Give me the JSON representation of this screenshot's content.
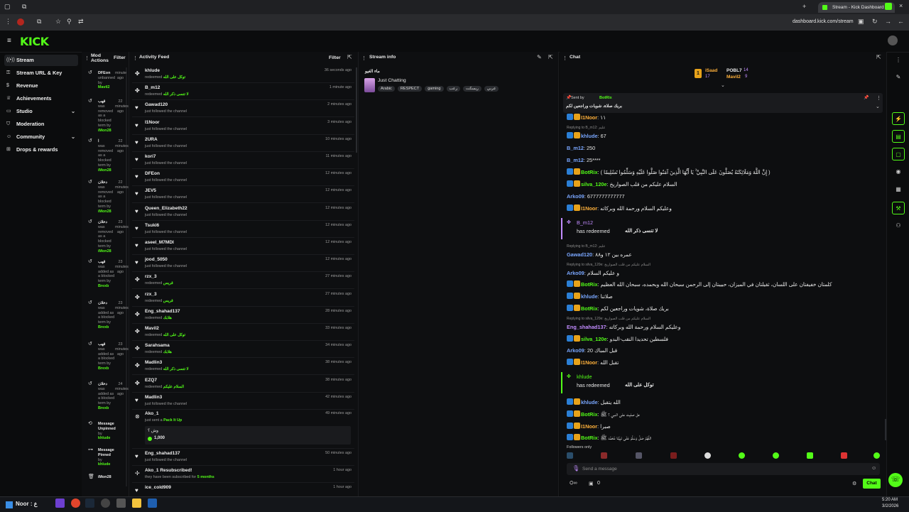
{
  "browser": {
    "tab_title": "Stream - Kick Dashboard",
    "url": "dashboard.kick.com/stream"
  },
  "app": {
    "logo": "KICK"
  },
  "sidebar": {
    "items": [
      {
        "label": "Stream",
        "icon": "broadcast-icon"
      },
      {
        "label": "Stream URL & Key",
        "icon": "key-icon"
      },
      {
        "label": "Revenue",
        "icon": "dollar-icon"
      },
      {
        "label": "Achievements",
        "icon": "trophy-icon"
      },
      {
        "label": "Studio",
        "icon": "studio-icon"
      },
      {
        "label": "Moderation",
        "icon": "shield-icon"
      },
      {
        "label": "Community",
        "icon": "people-icon"
      },
      {
        "label": "Drops & rewards",
        "icon": "gift-icon"
      }
    ]
  },
  "mod_actions": {
    "title": "Mod Actions",
    "filter": "Filter",
    "items": [
      {
        "name": "DFEon",
        "text": "unbanned by",
        "by": "Mavil2",
        "time": "minute ago"
      },
      {
        "name": "قهب",
        "text": "was removed as a blocked term by",
        "by": "iMon28",
        "time": "22 minutes ago"
      },
      {
        "name": "ا",
        "text": "was removed as a blocked term by",
        "by": "iMon28",
        "time": "22 minutes ago"
      },
      {
        "name": "دخلان",
        "text": "was removed as a blocked term by",
        "by": "iMon28",
        "time": "22 minutes ago"
      },
      {
        "name": "دخلان",
        "text": "was removed as a blocked term by",
        "by": "iMon28",
        "time": "23 minutes ago"
      },
      {
        "name": "قهب",
        "text": "was added as a blocked term by",
        "by": "Brexb",
        "time": "23 minutes ago"
      },
      {
        "name": "دخلان",
        "text": "was added as a blocked term by",
        "by": "Brexb",
        "time": "23 minutes ago"
      },
      {
        "name": "قهب",
        "text": "was added as a blocked term by",
        "by": "Brexb",
        "time": "23 minutes ago"
      },
      {
        "name": "دخلان",
        "text": "was added as a blocked term by",
        "by": "Brexb",
        "time": "24 minutes ago"
      },
      {
        "name": "Message Unpinned",
        "text": "by",
        "by": "khlude",
        "time": ""
      },
      {
        "name": "Message Pinned",
        "text": "by",
        "by": "khlude",
        "time": ""
      },
      {
        "name": "iMon28",
        "text": "",
        "by": "",
        "time": ""
      }
    ]
  },
  "activity_feed": {
    "title": "Activity Feed",
    "filter": "Filter",
    "items": [
      {
        "user": "khlude",
        "sub": "redeemed",
        "reward": "توكل على الله",
        "time": "36 seconds ago"
      },
      {
        "user": "B_m12",
        "sub": "redeemed",
        "reward": "لا تنسى ذكر الله",
        "time": "1 minute ago"
      },
      {
        "user": "Gawad120",
        "sub": "just followed the channel",
        "reward": "",
        "time": "2 minutes ago"
      },
      {
        "user": "I1Noor",
        "sub": "just followed the channel",
        "reward": "",
        "time": "3 minutes ago"
      },
      {
        "user": "2URA",
        "sub": "just followed the channel",
        "reward": "",
        "time": "10 minutes ago"
      },
      {
        "user": "kori7",
        "sub": "just followed the channel",
        "reward": "",
        "time": "11 minutes ago"
      },
      {
        "user": "DFEon",
        "sub": "just followed the channel",
        "reward": "",
        "time": "12 minutes ago"
      },
      {
        "user": "JEV5",
        "sub": "just followed the channel",
        "reward": "",
        "time": "12 minutes ago"
      },
      {
        "user": "Queen_Elizabeth22",
        "sub": "just followed the channel",
        "reward": "",
        "time": "12 minutes ago"
      },
      {
        "user": "Tsuki6",
        "sub": "just followed the channel",
        "reward": "",
        "time": "12 minutes ago"
      },
      {
        "user": "aseel_M7MDI",
        "sub": "just followed the channel",
        "reward": "",
        "time": "12 minutes ago"
      },
      {
        "user": "jood_5050",
        "sub": "just followed the channel",
        "reward": "",
        "time": "12 minutes ago"
      },
      {
        "user": "rzx_3",
        "sub": "redeemed",
        "reward": "قريس",
        "time": "27 minutes ago"
      },
      {
        "user": "rzx_3",
        "sub": "redeemed",
        "reward": "قريس",
        "time": "27 minutes ago"
      },
      {
        "user": "Eng_shahad137",
        "sub": "redeemed",
        "reward": "هلابك",
        "time": "28 minutes ago"
      },
      {
        "user": "Mavil2",
        "sub": "redeemed",
        "reward": "توكل على الله",
        "time": "33 minutes ago"
      },
      {
        "user": "Sarahsama",
        "sub": "redeemed",
        "reward": "هلابك",
        "time": "34 minutes ago"
      },
      {
        "user": "Madlin3",
        "sub": "redeemed",
        "reward": "لا تنسى ذكر الله",
        "time": "38 minutes ago"
      },
      {
        "user": "EZQ7",
        "sub": "redeemed",
        "reward": "السلام عليكم",
        "time": "38 minutes ago"
      },
      {
        "user": "Madlin3",
        "sub": "just followed the channel",
        "reward": "",
        "time": "42 minutes ago"
      }
    ],
    "kicks": {
      "user": "Ako_1",
      "sub": "just sent a",
      "gift": "Pack It Up",
      "time": "49 minutes ago",
      "msg": "وش ؟",
      "amount": "1,000"
    },
    "tail": [
      {
        "user": "Eng_shahad137",
        "sub": "just followed the channel",
        "time": "50 minutes ago"
      },
      {
        "user": "Ako_1 Resubscribed!",
        "sub": "they have been subscribed for",
        "months": "5 months",
        "time": "1 hour ago"
      },
      {
        "user": "ice_cold909",
        "sub": "",
        "time": "1 hour ago"
      }
    ]
  },
  "stream_info": {
    "title": "Stream info",
    "stream_title": "ماء الغيو",
    "category": "Just Chatting",
    "tags": [
      "Arabic",
      "RESPECT",
      "gaming",
      "رعب",
      "ريسكت",
      "عربي"
    ]
  },
  "chat": {
    "title": "Chat",
    "leaderboard": [
      {
        "rank": "1",
        "name": "iSaad",
        "points": "17"
      },
      {
        "name": "POBL7",
        "points": "14"
      },
      {
        "name": "Mavil2",
        "points": "9"
      }
    ],
    "pinned": {
      "label": "Sent by",
      "user": "BotRix",
      "text": "بريك صلاة، شويات وراجعين لكم"
    },
    "messages": [
      {
        "kind": "msg",
        "user": "I1Noor",
        "color": "orange",
        "text": "١١"
      },
      {
        "kind": "reply",
        "text": "Replying to B_m12: عليم"
      },
      {
        "kind": "msg",
        "user": "khlude",
        "color": "blue",
        "text": "67"
      },
      {
        "kind": "msg",
        "user": "B_m12",
        "color": "blue",
        "text": "250"
      },
      {
        "kind": "msg",
        "user": "B_m12",
        "color": "blue",
        "text": "25****"
      },
      {
        "kind": "msg",
        "user": "BotRix",
        "color": "green",
        "text": "( إِنَّ اللَّهَ وَمَلَائِكَتَهُ يُصَلُّونَ عَلَى النَّبِيِّ ۚ يَا أَيُّهَا الَّذِينَ آمَنُوا صَلُّوا عَلَيْهِ وَسَلِّمُوا تَسْلِيمًا )"
      },
      {
        "kind": "msg",
        "user": "silva_120e",
        "color": "green",
        "text": "السلام عليكم من قلب الصواريخ"
      },
      {
        "kind": "msg",
        "user": "Arko09",
        "color": "blue",
        "text": "6777777777777"
      },
      {
        "kind": "msg",
        "user": "I1Noor",
        "color": "orange",
        "text": "وعليكم السلام ورحمة الله وبركاته"
      },
      {
        "kind": "redeem",
        "user": "B_m12",
        "text": "has redeemed",
        "reward": "لا تنسى ذكر الله",
        "color": "purple"
      },
      {
        "kind": "reply",
        "text": "Replying to B_m12: عليم"
      },
      {
        "kind": "msg",
        "user": "Gawad120",
        "color": "blue",
        "text": "عمره بين ١٢ و٨٨"
      },
      {
        "kind": "reply",
        "text": "Replying to silva_120e: السلام عليكم من قلب الصواريخ"
      },
      {
        "kind": "msg",
        "user": "Arko09",
        "color": "blue",
        "text": "و عليكم السلام"
      },
      {
        "kind": "msg",
        "user": "BotRix",
        "color": "green",
        "text": "كلمتان خفيفتان على اللسان، ثقيلتان في الميزان، حبيبتان إلى الرحمن سبحان الله وبحمده، سبحان الله العظيم"
      },
      {
        "kind": "msg",
        "user": "khlude",
        "color": "blue",
        "text": "صلاتنا"
      },
      {
        "kind": "msg",
        "user": "BotRix",
        "color": "green",
        "text": "بريك صلاة، شويات وراجعين لكم"
      },
      {
        "kind": "reply",
        "text": "Replying to silva_120e: السلام عليكم من قلب الصواريخ"
      },
      {
        "kind": "msg",
        "user": "Eng_shahad137",
        "color": "purple",
        "text": "وعليكم السلام ورحمة الله وبركاته"
      },
      {
        "kind": "msg",
        "user": "silva_120e",
        "color": "green",
        "text": "فلسطين تحديدا النقب-البدو"
      },
      {
        "kind": "msg",
        "user": "Arko09",
        "color": "blue",
        "text": "20 قبل المباك"
      },
      {
        "kind": "msg",
        "user": "I1Noor",
        "color": "orange",
        "text": "تقبل الله"
      },
      {
        "kind": "redeem",
        "user": "khlude",
        "text": "has redeemed",
        "reward": "توكل على الله",
        "color": "green"
      },
      {
        "kind": "msg",
        "user": "khlude",
        "color": "blue",
        "text": "الله يتقبل"
      },
      {
        "kind": "msg",
        "user": "BotRix",
        "color": "green",
        "text": "هل صليت على النبي ؟ ﷺ"
      },
      {
        "kind": "msg",
        "user": "I1Noor",
        "color": "orange",
        "text": "صبرا"
      },
      {
        "kind": "msg",
        "user": "BotRix",
        "color": "green",
        "text": "اللَّهُمَّ صَلِّ وَسَلِّمْ عَلَى نَبِيِّنَا مُحَمَّد ﷺ"
      }
    ],
    "followers_only": "Followers only",
    "input_placeholder": "Send a message",
    "send_label": "Chat",
    "counter_left": "0",
    "counter_right": "0"
  },
  "taskbar": {
    "time": "5:20 AM",
    "date": "3/2/2026",
    "preview": "Noor : ع"
  }
}
